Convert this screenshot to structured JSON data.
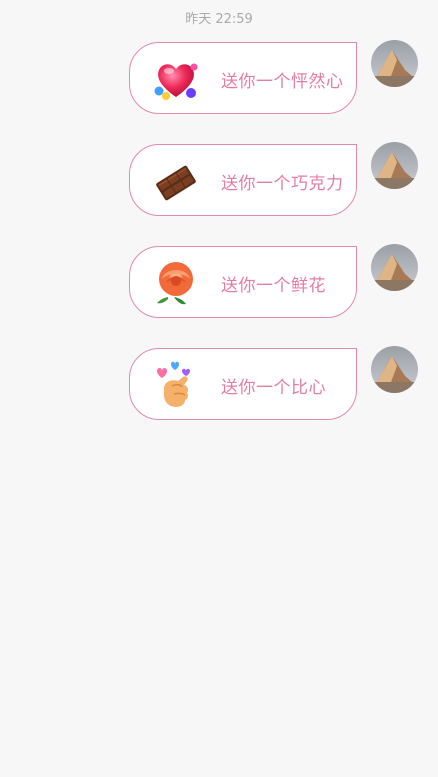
{
  "header": {
    "timestamp": "昨天 22:59"
  },
  "messages": [
    {
      "gift_label": "送你一个怦然心",
      "icon": "heart-icon"
    },
    {
      "gift_label": "送你一个巧克力",
      "icon": "chocolate-icon"
    },
    {
      "gift_label": "送你一个鲜花",
      "icon": "rose-icon"
    },
    {
      "gift_label": "送你一个比心",
      "icon": "finger-heart-icon"
    }
  ],
  "colors": {
    "bubble_border": "#e48aa8",
    "gift_text": "#e37ea0",
    "background": "#f8f7f7",
    "timestamp_text": "#a9a9a9"
  }
}
